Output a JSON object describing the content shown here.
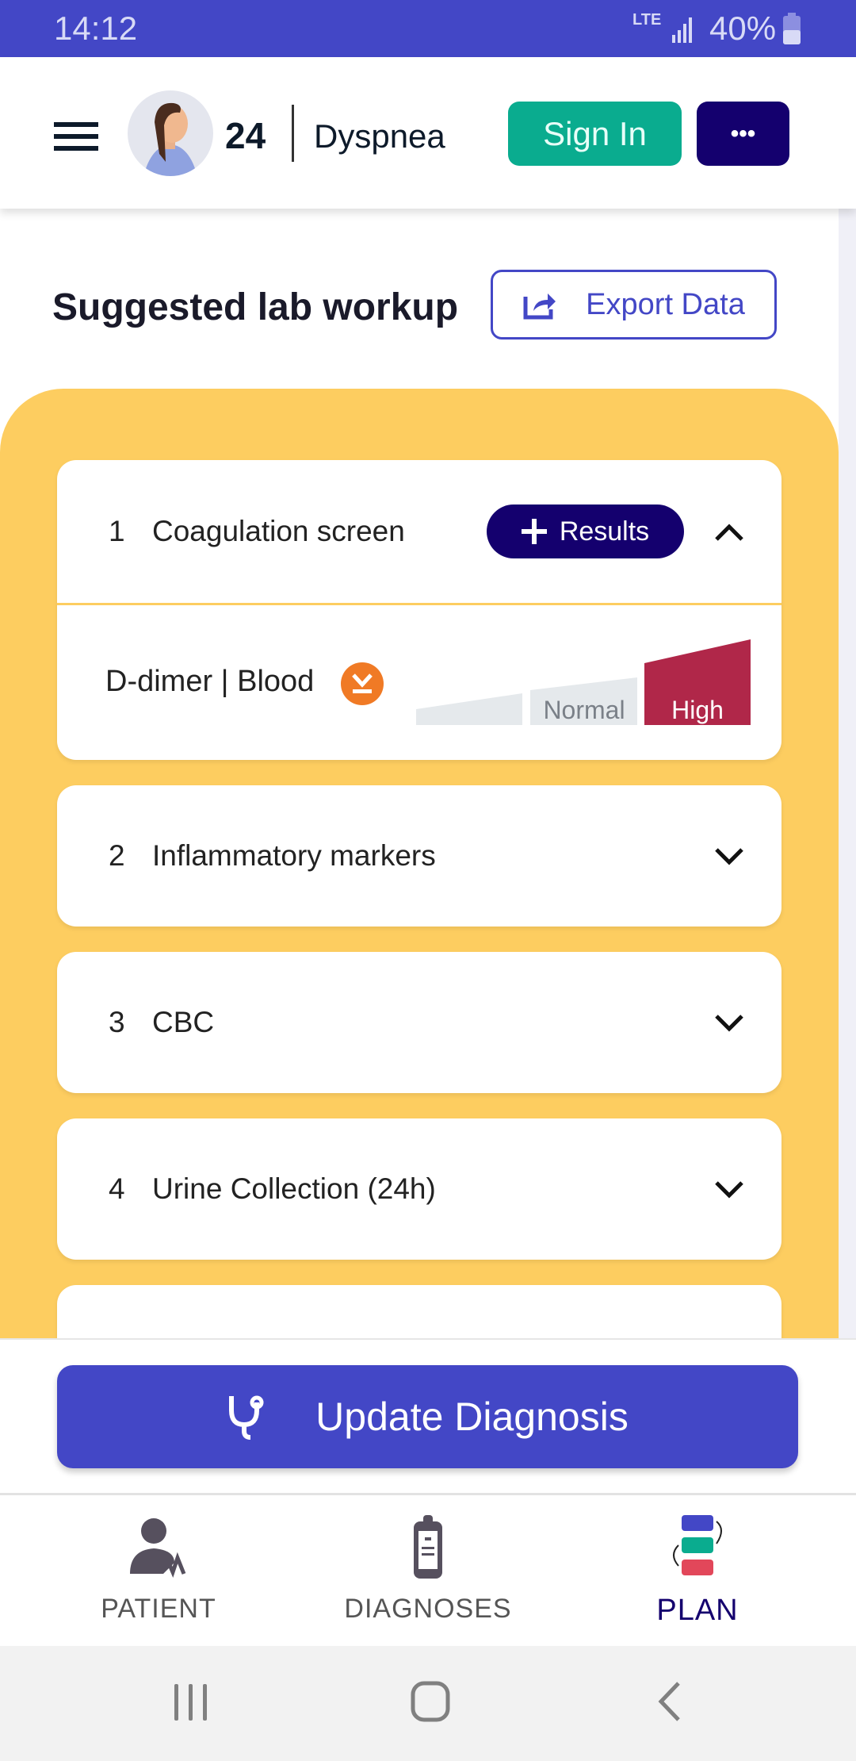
{
  "status_bar": {
    "time": "14:12",
    "network": "LTE",
    "battery": "40%"
  },
  "header": {
    "age": "24",
    "complaint": "Dyspnea",
    "sign_in_label": "Sign In",
    "more_label": "•••"
  },
  "section": {
    "title": "Suggested lab workup",
    "export_label": "Export Data"
  },
  "labs": [
    {
      "number": "1",
      "name": "Coagulation screen",
      "expanded": true,
      "results_label": "Results",
      "tests": [
        {
          "name": "D-dimer | Blood",
          "flag": "high",
          "scale": [
            "",
            "Normal",
            "High"
          ],
          "selected": "High"
        }
      ]
    },
    {
      "number": "2",
      "name": "Inflammatory markers",
      "expanded": false
    },
    {
      "number": "3",
      "name": "CBC",
      "expanded": false
    },
    {
      "number": "4",
      "name": "Urine Collection (24h)",
      "expanded": false
    }
  ],
  "update_button": {
    "label": "Update Diagnosis"
  },
  "bottom_nav": [
    {
      "label": "PATIENT",
      "active": false
    },
    {
      "label": "DIAGNOSES",
      "active": false
    },
    {
      "label": "PLAN",
      "active": true
    }
  ],
  "colors": {
    "primary": "#4347c6",
    "navy": "#14006e",
    "green": "#0aac8f",
    "yellow": "#fdcd60",
    "high": "#b02749",
    "flag": "#f07a25"
  }
}
